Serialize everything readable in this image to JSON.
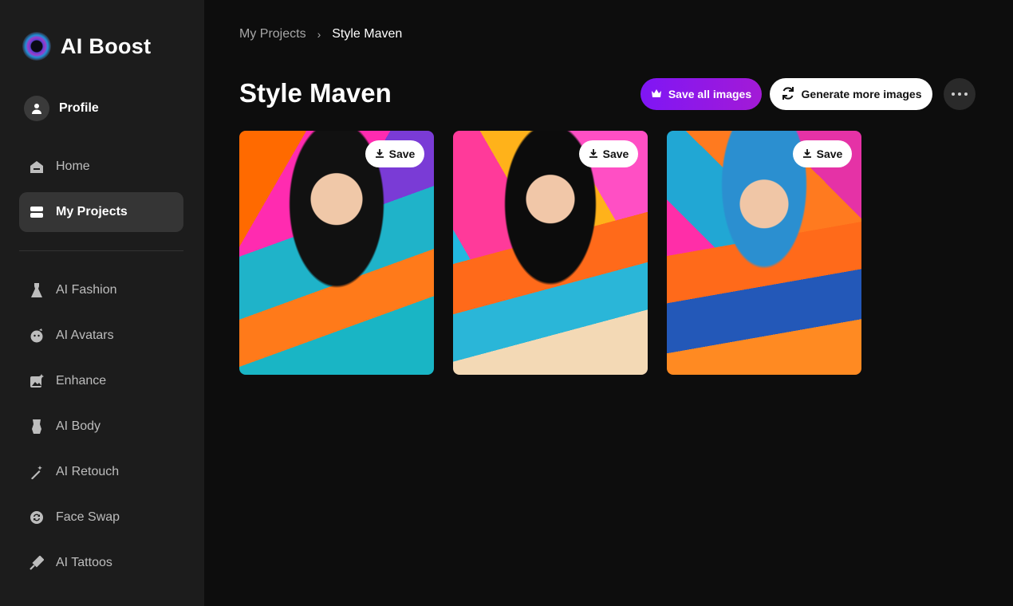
{
  "app": {
    "name": "AI Boost"
  },
  "sidebar": {
    "profile_label": "Profile",
    "primary": [
      {
        "label": "Home",
        "icon": "home-icon"
      },
      {
        "label": "My Projects",
        "icon": "projects-icon",
        "active": true
      }
    ],
    "tools": [
      {
        "label": "AI Fashion",
        "icon": "dress-icon"
      },
      {
        "label": "AI Avatars",
        "icon": "avatar-face-icon"
      },
      {
        "label": "Enhance",
        "icon": "enhance-icon"
      },
      {
        "label": "AI Body",
        "icon": "body-icon"
      },
      {
        "label": "AI Retouch",
        "icon": "magic-wand-icon"
      },
      {
        "label": "Face Swap",
        "icon": "swap-icon"
      },
      {
        "label": "AI Tattoos",
        "icon": "tattoo-machine-icon"
      }
    ]
  },
  "breadcrumb": {
    "parent": "My Projects",
    "separator": "›",
    "current": "Style Maven"
  },
  "page": {
    "title": "Style Maven"
  },
  "actions": {
    "save_all": "Save all images",
    "generate_more": "Generate more images"
  },
  "images": [
    {
      "save_label": "Save"
    },
    {
      "save_label": "Save"
    },
    {
      "save_label": "Save"
    }
  ],
  "colors": {
    "accent": "#8a16f0",
    "sidebar_bg": "#1c1c1c",
    "main_bg": "#0d0d0d",
    "active_nav": "#353535"
  }
}
